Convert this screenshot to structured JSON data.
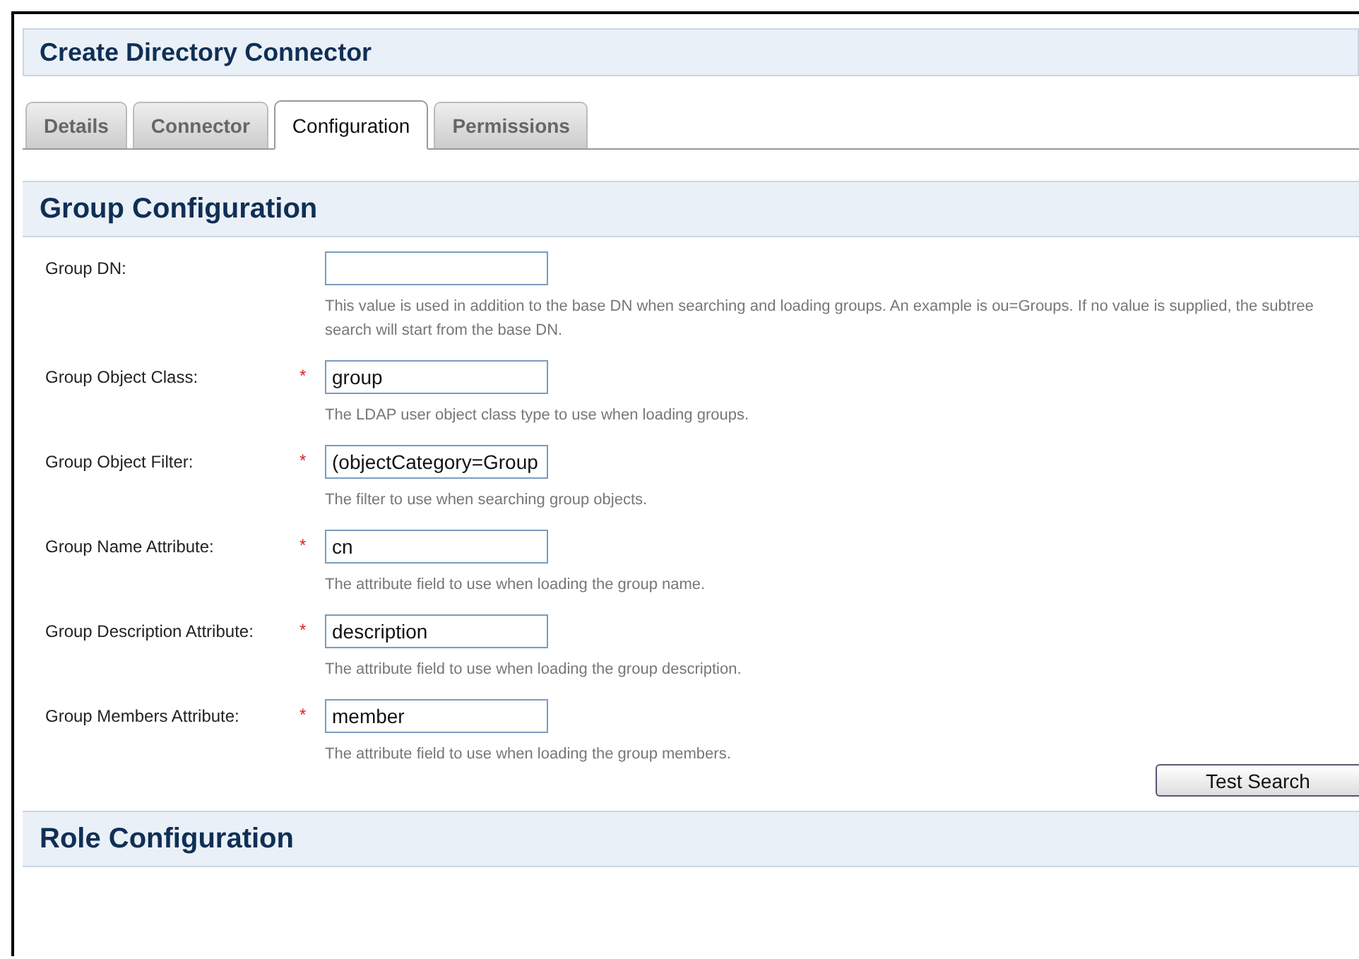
{
  "page_title": "Create Directory Connector",
  "tabs": [
    {
      "label": "Details",
      "selected": false
    },
    {
      "label": "Connector",
      "selected": false
    },
    {
      "label": "Configuration",
      "selected": true
    },
    {
      "label": "Permissions",
      "selected": false
    }
  ],
  "group_section": {
    "title": "Group Configuration",
    "fields": [
      {
        "label": "Group DN:",
        "help": "This value is used in addition to the base DN when searching and loading groups. An example is ou=Groups. If no value is supplied, the subtree search will start from the base DN."
      },
      {
        "label": "Group Object Class:",
        "required_mark": "*",
        "value": "group",
        "help": "The LDAP user object class type to use when loading groups."
      },
      {
        "label": "Group Object Filter:",
        "required_mark": "*",
        "value": "(objectCategory=Group",
        "help": "The filter to use when searching group objects."
      },
      {
        "label": "Group Name Attribute:",
        "required_mark": "*",
        "value": "cn",
        "help": "The attribute field to use when loading the group name."
      },
      {
        "label": "Group Description Attribute:",
        "required_mark": "*",
        "value": "description",
        "help": "The attribute field to use when loading the group description."
      },
      {
        "label": "Group Members Attribute:",
        "required_mark": "*",
        "value": "member",
        "help": "The attribute field to use when loading the group members."
      }
    ],
    "button": "Test Search"
  },
  "role_section": {
    "title": "Role Configuration"
  }
}
